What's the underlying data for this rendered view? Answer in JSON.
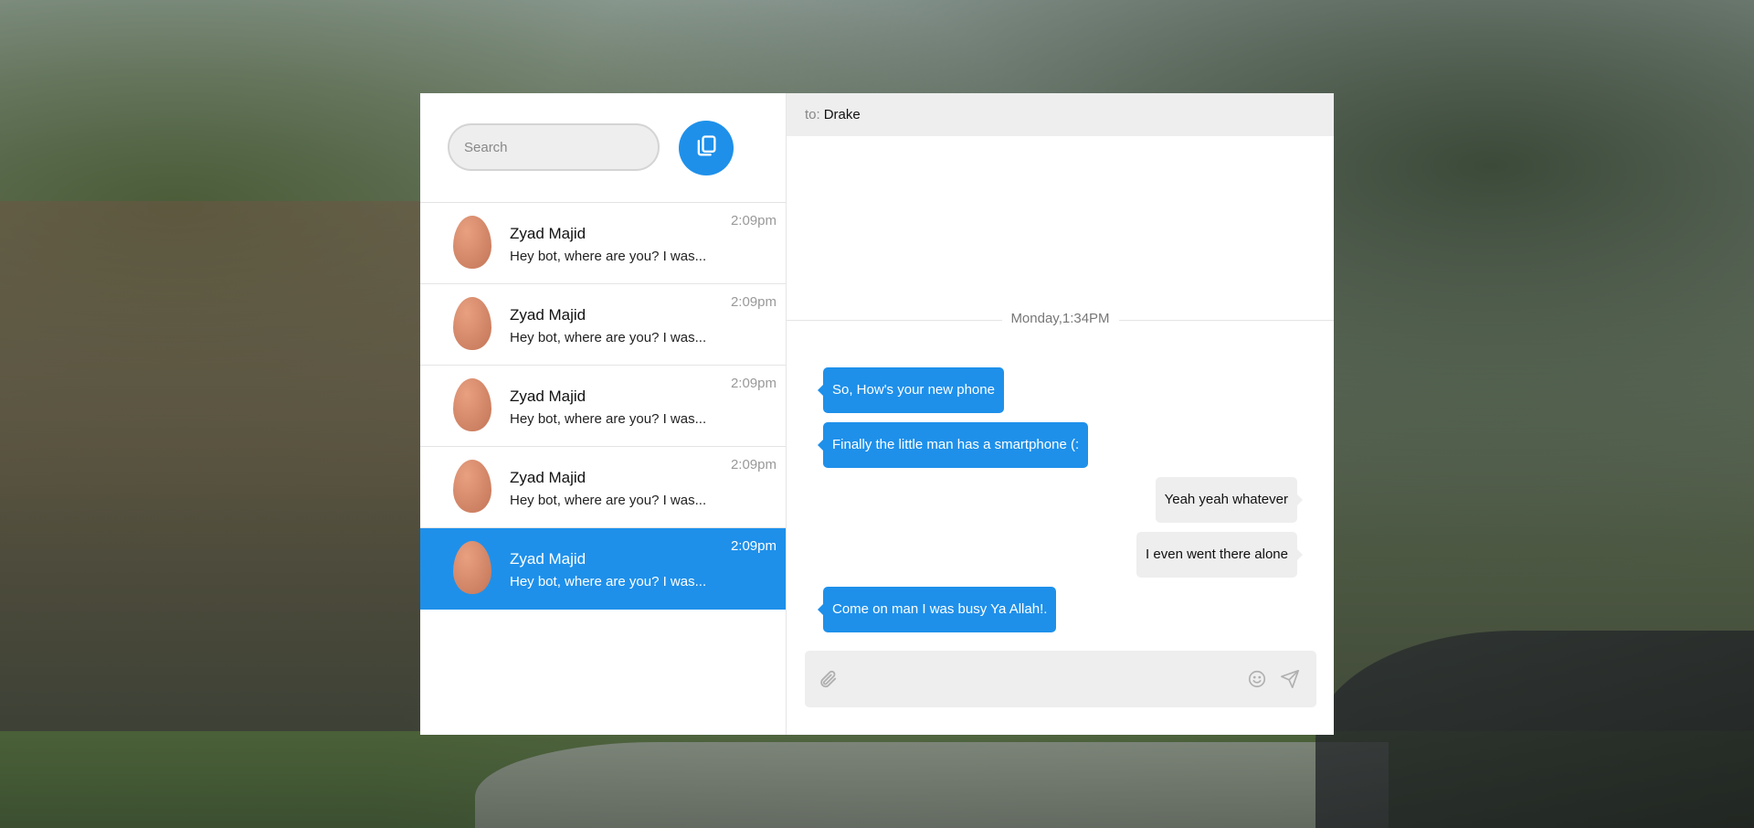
{
  "sidebar": {
    "search": {
      "placeholder": "Search",
      "value": ""
    },
    "compose_icon": "copy-icon",
    "conversations": [
      {
        "name": "Zyad Majid",
        "preview": "Hey bot, where are you? I was...",
        "time": "2:09pm",
        "active": false
      },
      {
        "name": "Zyad Majid",
        "preview": "Hey bot, where are you? I was...",
        "time": "2:09pm",
        "active": false
      },
      {
        "name": "Zyad Majid",
        "preview": "Hey bot, where are you? I was...",
        "time": "2:09pm",
        "active": false
      },
      {
        "name": "Zyad Majid",
        "preview": "Hey bot, where are you? I was...",
        "time": "2:09pm",
        "active": false
      },
      {
        "name": "Zyad Majid",
        "preview": "Hey bot, where are you? I was...",
        "time": "2:09pm",
        "active": true
      }
    ]
  },
  "chat": {
    "to_label": "to:",
    "to_name": "Drake",
    "date_divider": "Monday,1:34PM",
    "messages": [
      {
        "text": "So, How's your new phone",
        "from": "you"
      },
      {
        "text": "Finally the little man has a smartphone (:",
        "from": "you"
      },
      {
        "text": "Yeah yeah whatever",
        "from": "me"
      },
      {
        "text": "I even went there alone",
        "from": "me"
      },
      {
        "text": "Come on man I was busy Ya Allah!.",
        "from": "you"
      }
    ],
    "composer": {
      "placeholder": "",
      "attach_icon": "paperclip-icon",
      "emoji_icon": "smiley-icon",
      "send_icon": "send-icon"
    }
  },
  "colors": {
    "accent": "#1e90ea",
    "panel_grey": "#eeeeee",
    "text_muted": "#999999"
  }
}
